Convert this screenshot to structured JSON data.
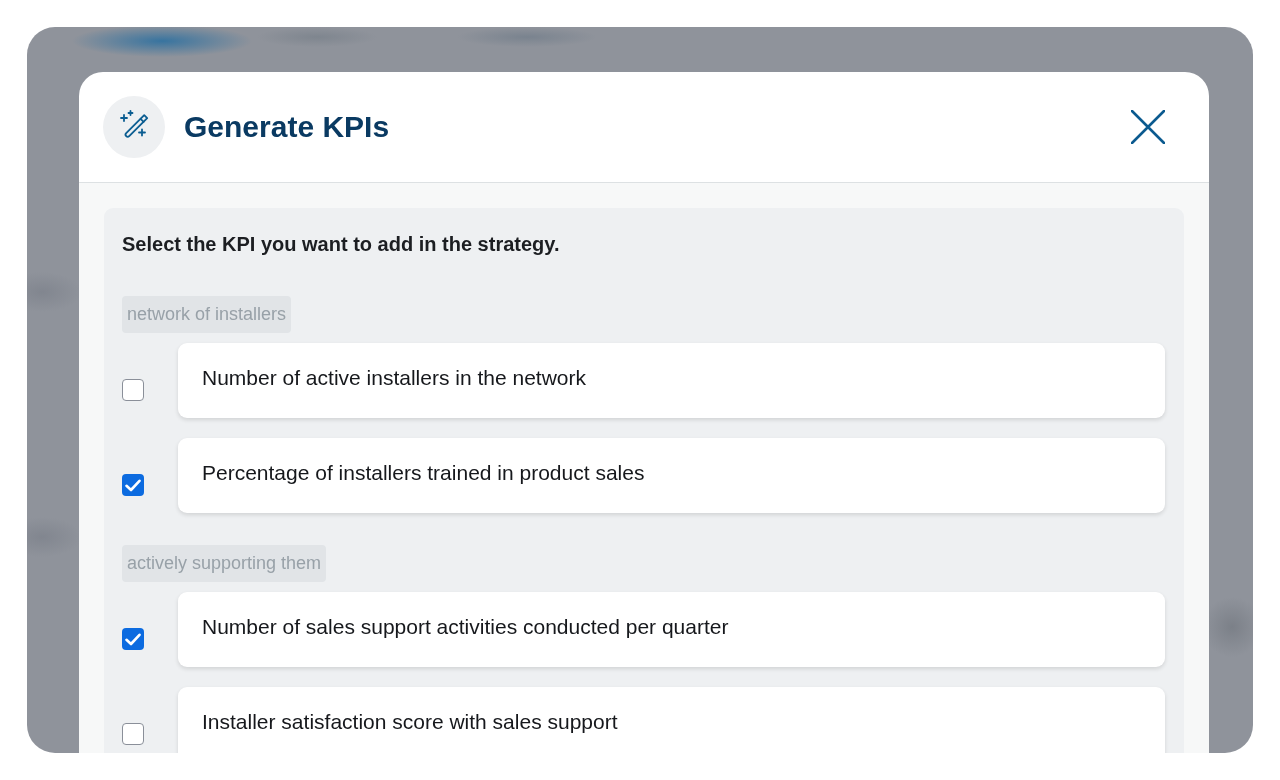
{
  "dialog": {
    "title": "Generate KPIs",
    "instruction": "Select the KPI you want to add in the strategy.",
    "groups": [
      {
        "label": "network of installers",
        "kpis": [
          {
            "text": "Number of active installers in the network",
            "checked": false
          },
          {
            "text": "Percentage of installers trained in product sales",
            "checked": true
          }
        ]
      },
      {
        "label": "actively supporting them",
        "kpis": [
          {
            "text": "Number of sales support activities conducted per quarter",
            "checked": true
          },
          {
            "text": "Installer satisfaction score with sales support",
            "checked": false
          }
        ]
      }
    ]
  }
}
